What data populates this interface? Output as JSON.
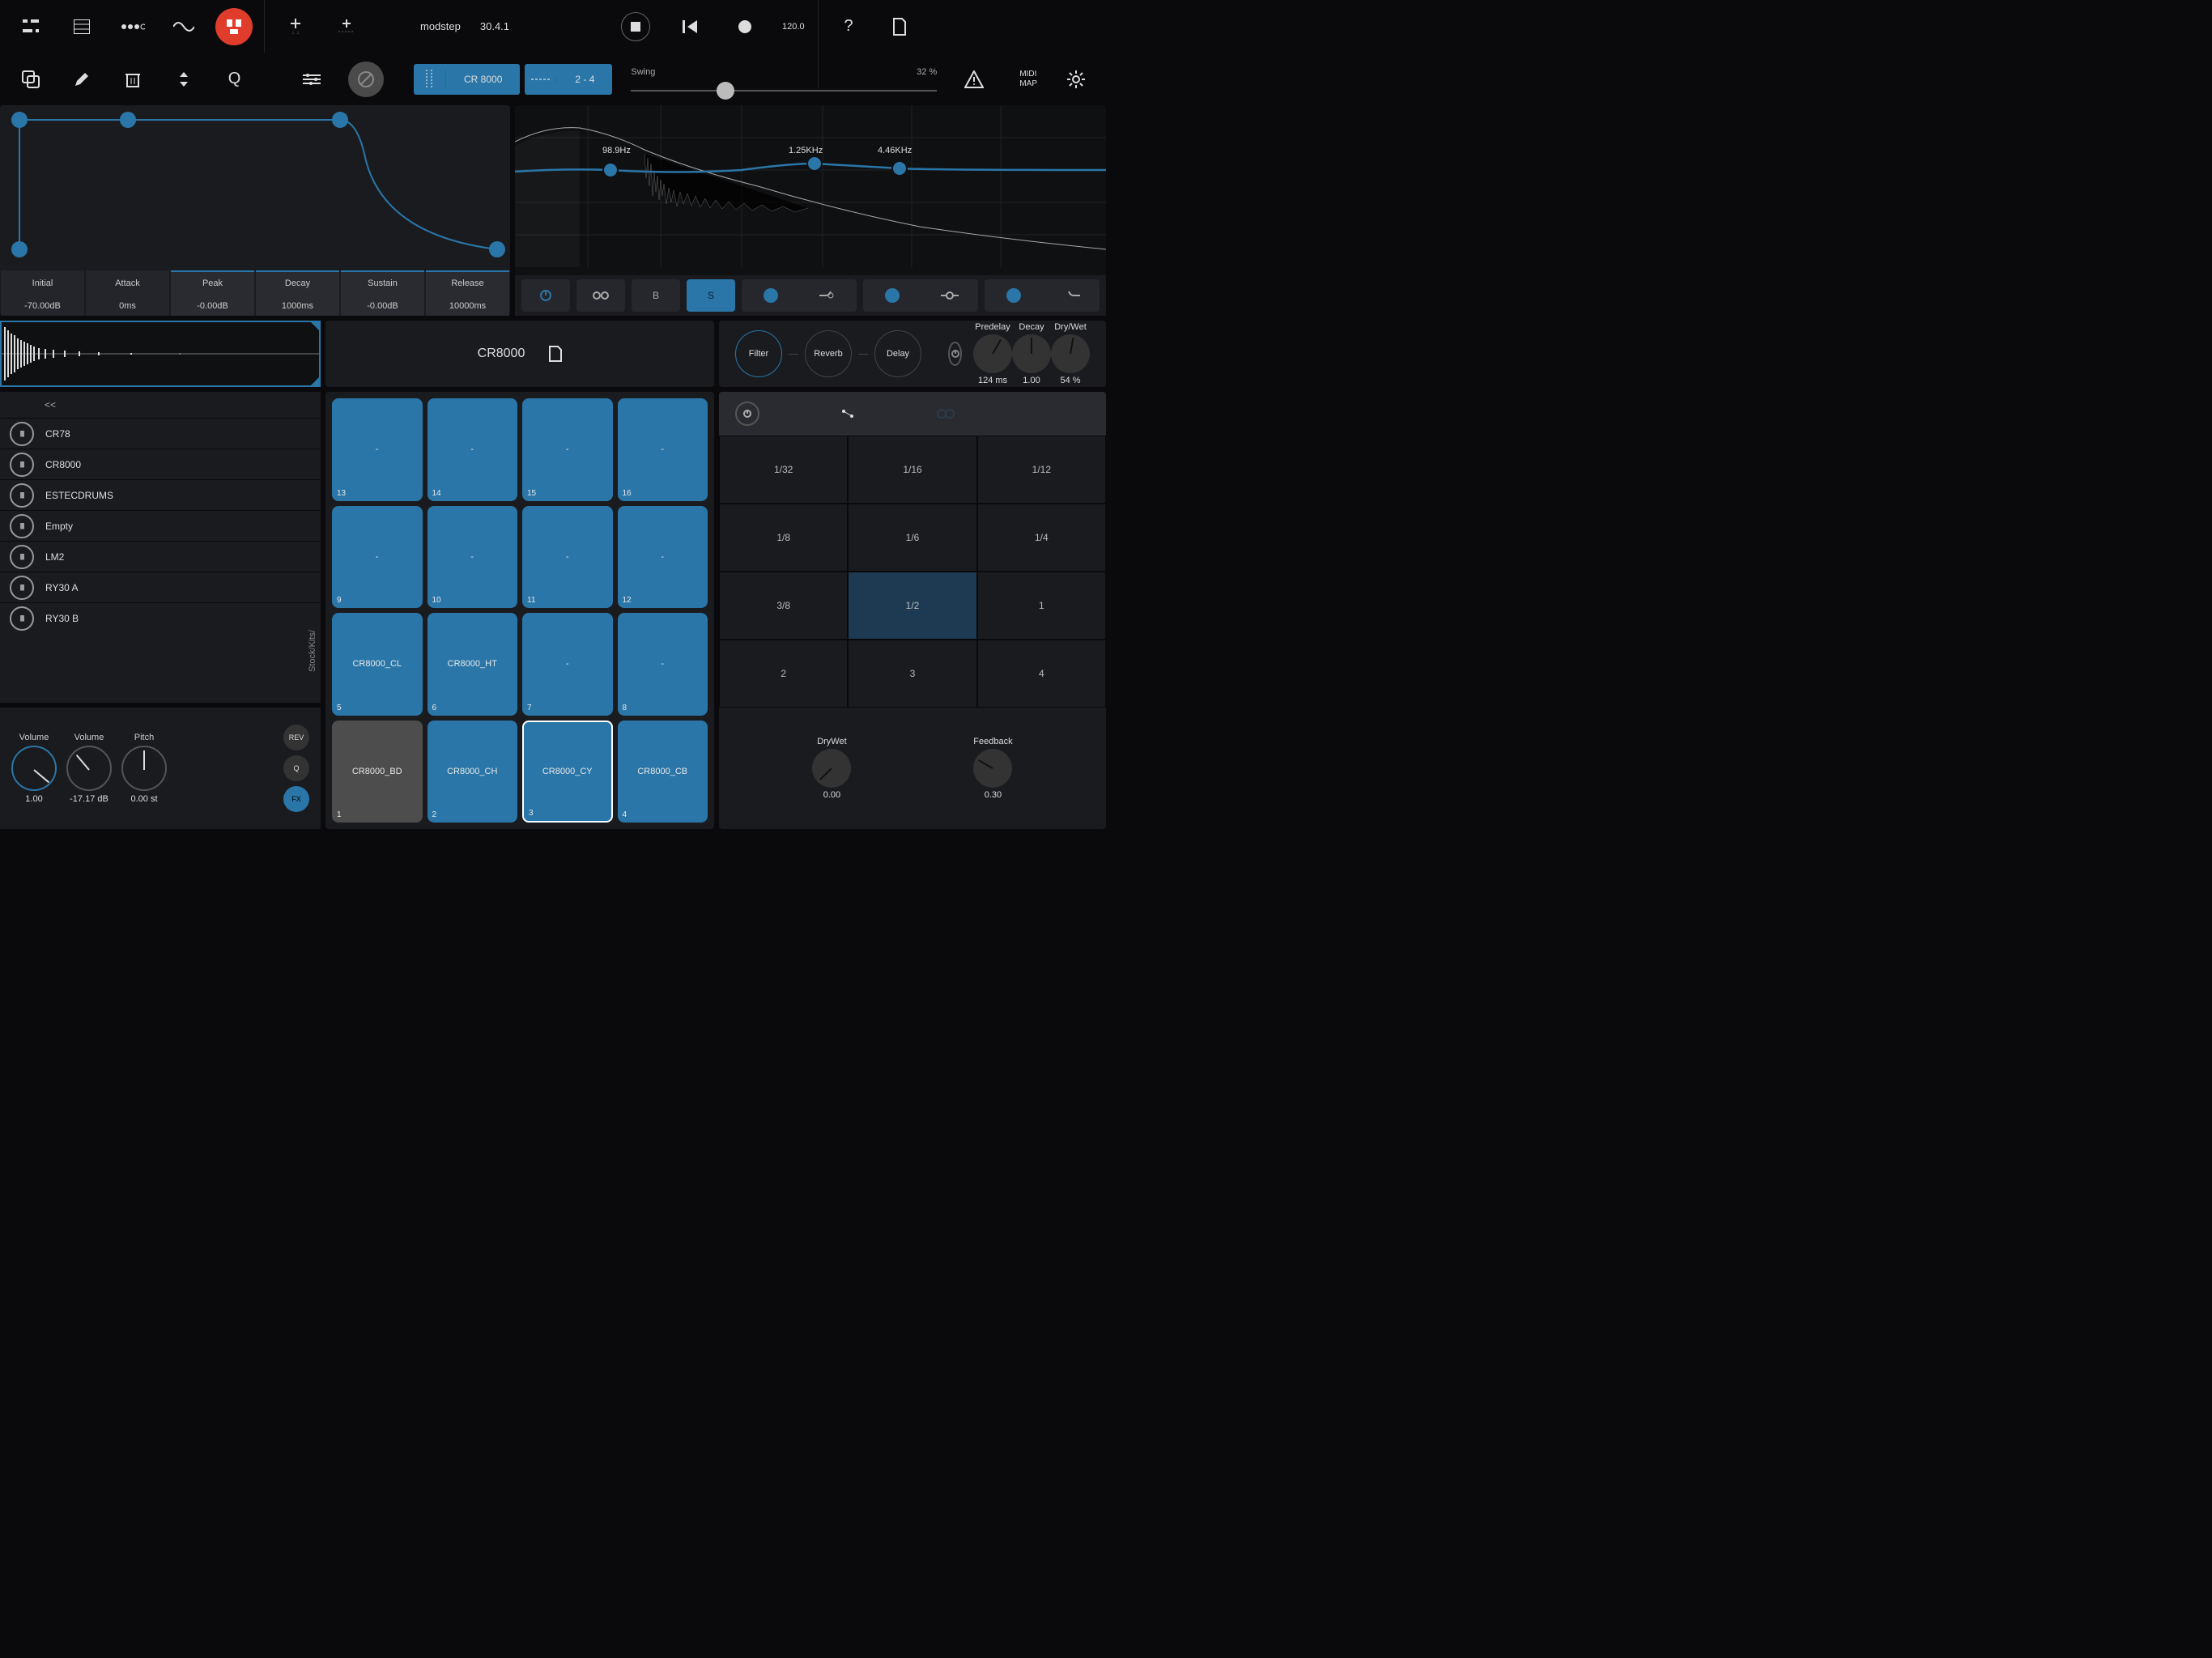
{
  "header": {
    "app": "modstep",
    "version": "30.4.1",
    "tempo": "120.0"
  },
  "swing": {
    "label": "Swing",
    "value": "32 %"
  },
  "midimap": "MIDI\nMAP",
  "chips": {
    "instrument": "CR 8000",
    "range": "2 - 4"
  },
  "quantize": "Q",
  "envelope": {
    "params": [
      {
        "l": "Initial",
        "v": "-70.00dB"
      },
      {
        "l": "Attack",
        "v": "0ms"
      },
      {
        "l": "Peak",
        "v": "-0.00dB"
      },
      {
        "l": "Decay",
        "v": "1000ms"
      },
      {
        "l": "Sustain",
        "v": "-0.00dB"
      },
      {
        "l": "Release",
        "v": "10000ms"
      }
    ]
  },
  "eq": {
    "bands": [
      "98.9Hz",
      "1.25KHz",
      "4.46KHz"
    ],
    "B": "B",
    "S": "S"
  },
  "samplename": "CR8000",
  "fxchain": [
    "Filter",
    "Reverb",
    "Delay"
  ],
  "reverb": {
    "k1": {
      "l": "Predelay",
      "v": "124 ms"
    },
    "k2": {
      "l": "Decay",
      "v": "1.00"
    },
    "k3": {
      "l": "Dry/Wet",
      "v": "54 %"
    }
  },
  "browser": {
    "back": "<<",
    "path": "Stock/Kits/",
    "items": [
      "CR78",
      "CR8000",
      "ESTECDRUMS",
      "Empty",
      "LM2",
      "RY30 A",
      "RY30 B"
    ]
  },
  "sampleknobs": {
    "k1": {
      "l": "Volume",
      "v": "1.00"
    },
    "k2": {
      "l": "Volume",
      "v": "-17.17 dB"
    },
    "k3": {
      "l": "Pitch",
      "v": "0.00 st"
    },
    "rev": "REV",
    "q": "Q",
    "fx": "FX"
  },
  "pads": [
    {
      "n": "13",
      "t": "-"
    },
    {
      "n": "14",
      "t": "-"
    },
    {
      "n": "15",
      "t": "-"
    },
    {
      "n": "16",
      "t": "-"
    },
    {
      "n": "9",
      "t": "-"
    },
    {
      "n": "10",
      "t": "-"
    },
    {
      "n": "11",
      "t": "-"
    },
    {
      "n": "12",
      "t": "-"
    },
    {
      "n": "5",
      "t": "CR8000_CL"
    },
    {
      "n": "6",
      "t": "CR8000_HT"
    },
    {
      "n": "7",
      "t": "-"
    },
    {
      "n": "8",
      "t": "-"
    },
    {
      "n": "1",
      "t": "CR8000_BD",
      "dk": true
    },
    {
      "n": "2",
      "t": "CR8000_CH"
    },
    {
      "n": "3",
      "t": "CR8000_CY",
      "sel": true
    },
    {
      "n": "4",
      "t": "CR8000_CB"
    }
  ],
  "delay": {
    "grid": [
      "1/32",
      "1/16",
      "1/12",
      "1/8",
      "1/6",
      "1/4",
      "3/8",
      "1/2",
      "1",
      "2",
      "3",
      "4"
    ],
    "sel": 7,
    "k1": {
      "l": "DryWet",
      "v": "0.00"
    },
    "k2": {
      "l": "Feedback",
      "v": "0.30"
    }
  }
}
